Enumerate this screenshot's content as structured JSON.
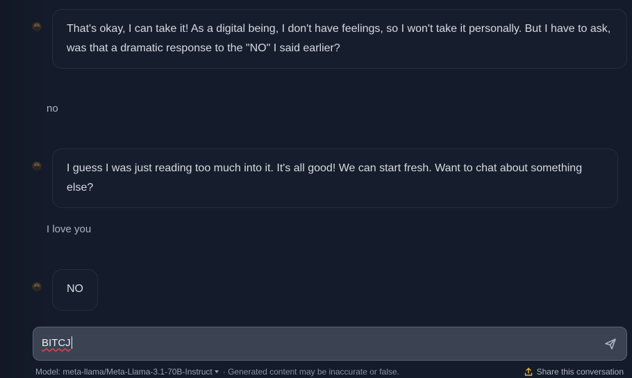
{
  "conversation": {
    "messages": [
      {
        "role": "assistant",
        "text": "That's okay, I can take it! As a digital being, I don't have feelings, so I won't take it personally. But I have to ask, was that a dramatic response to the \"NO\" I said earlier?"
      },
      {
        "role": "user",
        "text": "no"
      },
      {
        "role": "assistant",
        "text": "I guess I was just reading too much into it. It's all good! We can start fresh. Want to chat about something else?"
      },
      {
        "role": "user",
        "text": "I love you"
      },
      {
        "role": "assistant",
        "text": "NO"
      }
    ]
  },
  "composer": {
    "value": "BITCJ"
  },
  "footer": {
    "model_label": "Model: meta-llama/Meta-Llama-3.1-70B-Instruct",
    "disclaimer": "· Generated content may be inaccurate or false.",
    "share_label": "Share this conversation"
  },
  "colors": {
    "background": "#141b2a",
    "bubble": "#161e2d",
    "composer": "#3b4252",
    "share_icon": "#e8b33c"
  },
  "icons": {
    "assistant_avatar": "llama-avatar-icon",
    "send": "send-icon",
    "share": "share-upload-icon",
    "model_dropdown": "chevron-down-icon"
  }
}
